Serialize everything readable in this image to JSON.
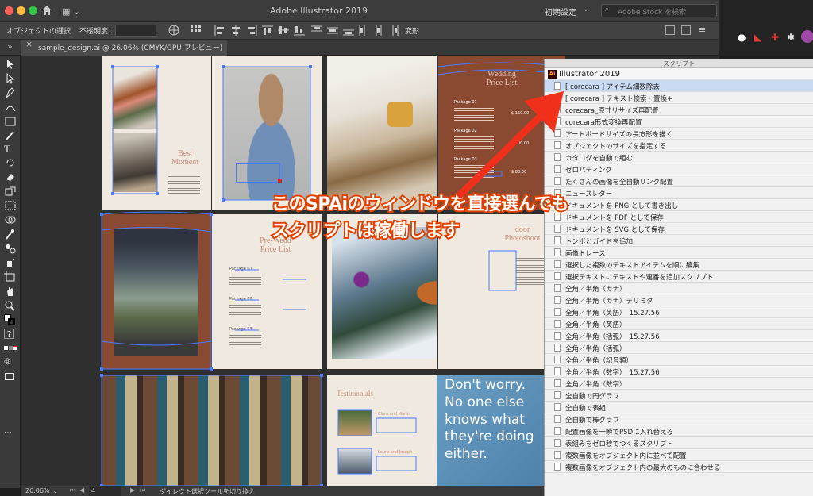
{
  "window": {
    "title": "Adobe Illustrator 2019",
    "workspace_preset": "初期設定",
    "stock_search_placeholder": "Adobe Stock を検索"
  },
  "control_bar": {
    "selection_label": "オブジェクトの選択",
    "opacity_label": "不透明度：",
    "transform_label": "変形"
  },
  "document_tab": {
    "label": "sample_design.ai @ 26.06% (CMYK/GPU プレビュー)",
    "close": "×"
  },
  "artboards": {
    "best_moment": "Best\nMoment",
    "wedding_price": "Wedding\nPrice List",
    "pre_wedding": "Pre-Wedd\nPrice List",
    "door_photoshoot": "door\nPhotoshoot",
    "testimonials": "Testimonials",
    "clara": "Clara and Martin",
    "laura": "Laura and Joseph",
    "dont_worry": "Don't worry.\nNo one else\nknows what\nthey're doing\neither.",
    "package_01": "Package 01",
    "package_02": "Package 02",
    "package_03": "Package 03",
    "price_1": "$ 150.00",
    "price_2": "$ 100.00",
    "price_3": "$ 80.00"
  },
  "status_bar": {
    "zoom": "26.06%",
    "page": "4",
    "tool_hint": "ダイレクト選択ツールを切り換え"
  },
  "scripts_panel": {
    "header": "スクリプト",
    "root": "Illustrator 2019",
    "items": [
      "[ corecara ] アイテム細数除去",
      "[ corecara ] テキスト検索・置換+",
      "corecara_原寸リサイズ再配置",
      "corecara形式変換再配置",
      "アートボードサイズの長方形を描く",
      "オブジェクトのサイズを指定する",
      "カタログを自動で組む",
      "ゼロパディング",
      "たくさんの画像を全自動リンク配置",
      "ニュースレター",
      "ドキュメントを PNG として書き出し",
      "ドキュメントを PDF として保存",
      "ドキュメントを SVG として保存",
      "トンボとガイドを追加",
      "画像トレース",
      "選択した複数のテキストアイテムを順に編集",
      "選択テキストにテキストや連番を追加スクリプト",
      "全角／半角（カナ）",
      "全角／半角（カナ）デリミタ",
      "全角／半角（英語）　15.27.56",
      "全角／半角（英語）",
      "全角／半角（括弧）　15.27.56",
      "全角／半角（括弧）",
      "全角／半角（記号類）",
      "全角／半角（数字）　15.27.56",
      "全角／半角（数字）",
      "全自動で円グラフ",
      "全自動で表組",
      "全自動で棒グラフ",
      "配置画像を一瞬でPSDに入れ替える",
      "表組みをゼロ秒でつくるスクリプト",
      "複数画像をオブジェクト内に並べて配置",
      "複数画像をオブジェクト内の最大のものに合わせる"
    ]
  },
  "callout": {
    "line1": "このSPAiのウィンドウを直接選んでも",
    "line2": "スクリプトは稼働します"
  },
  "colors": {
    "accent_blue": "#4a7cff",
    "rust": "#8a4a32",
    "callout_orange": "#e04100",
    "arrow_red": "#f0301a"
  }
}
